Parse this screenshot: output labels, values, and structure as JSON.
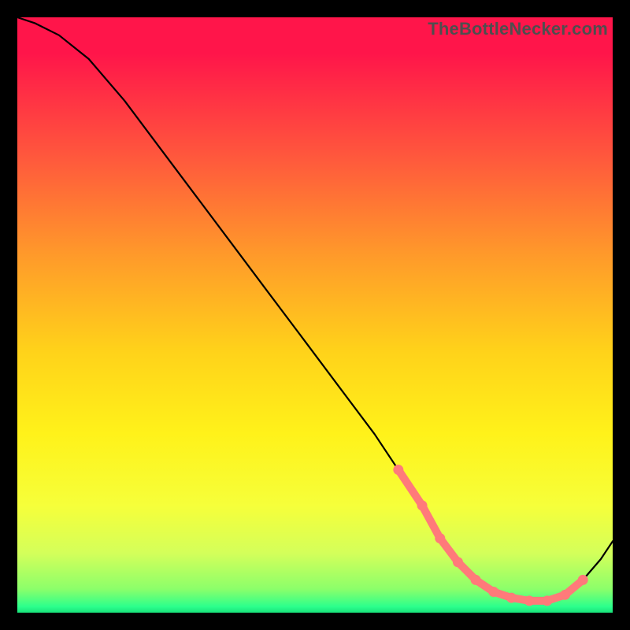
{
  "watermark": "TheBottleNecker.com",
  "chart_data": {
    "type": "line",
    "title": "",
    "xlabel": "",
    "ylabel": "",
    "xlim": [
      0,
      100
    ],
    "ylim": [
      0,
      100
    ],
    "x": [
      0,
      3,
      7,
      12,
      18,
      24,
      30,
      36,
      42,
      48,
      54,
      60,
      64,
      68,
      71,
      74,
      77,
      80,
      83,
      86,
      89,
      92,
      95,
      98,
      100
    ],
    "values": [
      100,
      99,
      97,
      93,
      86,
      78,
      70,
      62,
      54,
      46,
      38,
      30,
      24,
      18,
      12.5,
      8.5,
      5.5,
      3.5,
      2.5,
      2,
      2,
      3,
      5.5,
      9,
      12
    ],
    "markers": {
      "x": [
        64,
        68,
        71,
        74,
        77,
        80,
        83,
        86,
        89,
        92,
        95
      ],
      "y": [
        24,
        18,
        12.5,
        8.5,
        5.5,
        3.5,
        2.5,
        2,
        2,
        3,
        5.5
      ],
      "color": "#ff7a7a"
    },
    "colors": {
      "curve": "#000000",
      "background_top": "#ff154a",
      "background_bottom": "#18e27a"
    }
  }
}
